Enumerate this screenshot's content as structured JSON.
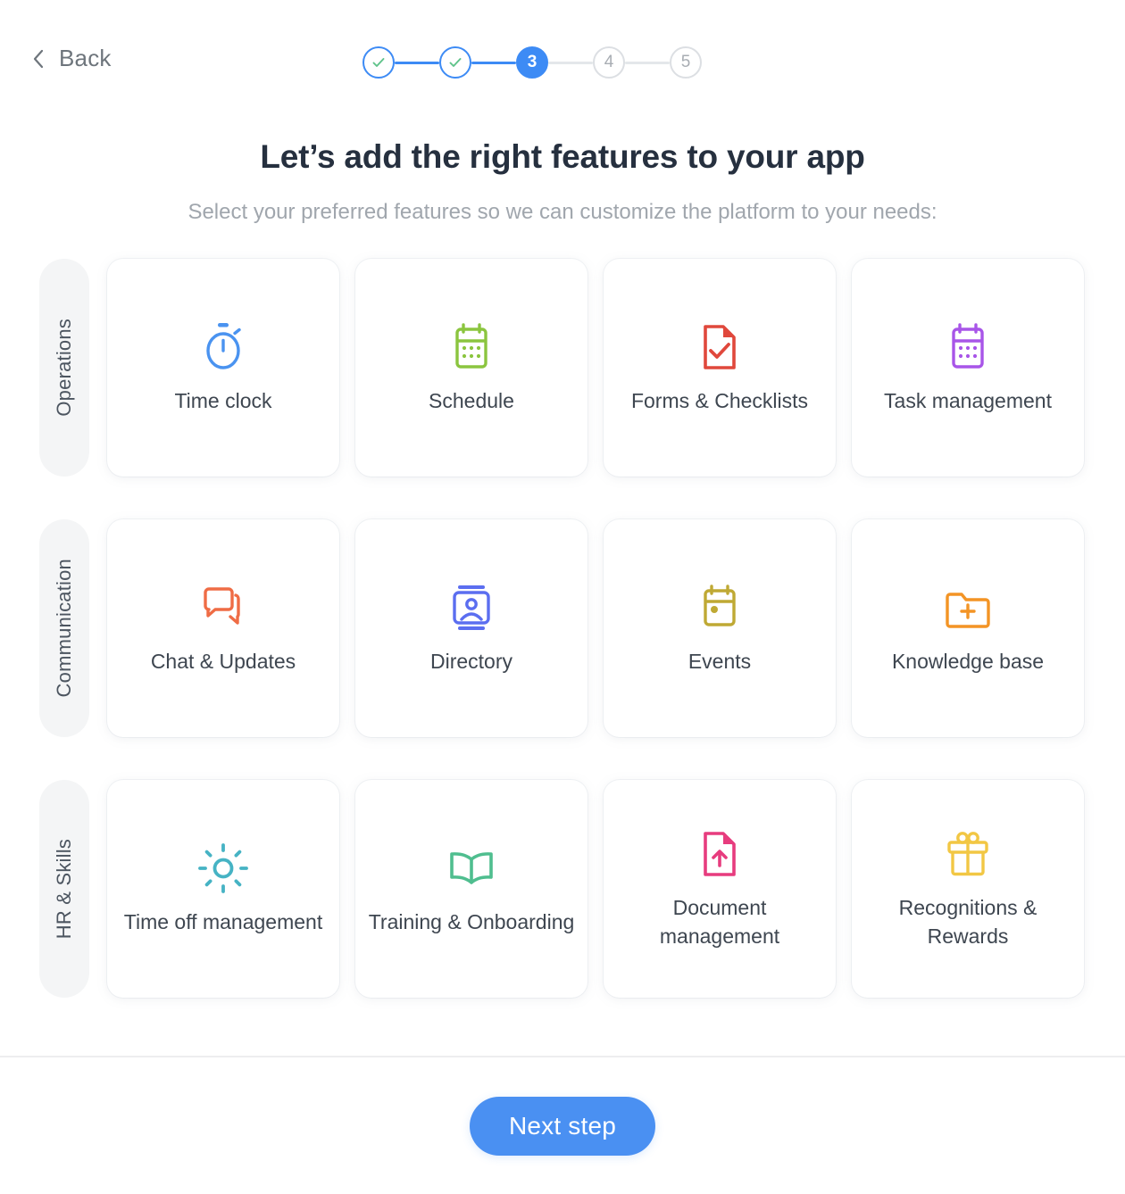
{
  "header": {
    "back_label": "Back",
    "back_icon": "chevron-left-icon",
    "stepper": {
      "steps": [
        {
          "label": "1",
          "state": "done"
        },
        {
          "label": "2",
          "state": "done"
        },
        {
          "label": "3",
          "state": "active"
        },
        {
          "label": "4",
          "state": "todo"
        },
        {
          "label": "5",
          "state": "todo"
        }
      ],
      "current_step": 3,
      "total_steps": 5,
      "active_color": "#3d8bf5",
      "check_color": "#5fc38a",
      "inactive_color": "#dcdfe3"
    }
  },
  "main": {
    "title": "Let’s add the right features to your app",
    "subtitle": "Select your preferred features so we can customize the platform to your needs:",
    "groups": [
      {
        "category": "Operations",
        "cards": [
          {
            "label": "Time clock",
            "icon": "stopwatch-icon",
            "color": "#4a93f0"
          },
          {
            "label": "Schedule",
            "icon": "calendar-icon",
            "color": "#8bc53f"
          },
          {
            "label": "Forms & Checklists",
            "icon": "document-check-icon",
            "color": "#e0483c"
          },
          {
            "label": "Task management",
            "icon": "calendar-tasks-icon",
            "color": "#a855e8"
          }
        ]
      },
      {
        "category": "Communication",
        "cards": [
          {
            "label": "Chat & Updates",
            "icon": "chat-bubbles-icon",
            "color": "#ef6c45"
          },
          {
            "label": "Directory",
            "icon": "profile-card-icon",
            "color": "#5b6ef0"
          },
          {
            "label": "Events",
            "icon": "calendar-event-icon",
            "color": "#bfa934"
          },
          {
            "label": "Knowledge base",
            "icon": "folder-plus-icon",
            "color": "#f39425"
          }
        ]
      },
      {
        "category": "HR & Skills",
        "cards": [
          {
            "label": "Time off management",
            "icon": "sun-icon",
            "color": "#46b3c4"
          },
          {
            "label": "Training & Onboarding",
            "icon": "open-book-icon",
            "color": "#4fbe8f"
          },
          {
            "label": "Document management",
            "icon": "document-upload-icon",
            "color": "#e73c7e"
          },
          {
            "label": "Recognitions & Rewards",
            "icon": "gift-icon",
            "color": "#f2c744"
          }
        ]
      }
    ]
  },
  "footer": {
    "next_label": "Next step",
    "next_color": "#4a90f2"
  }
}
